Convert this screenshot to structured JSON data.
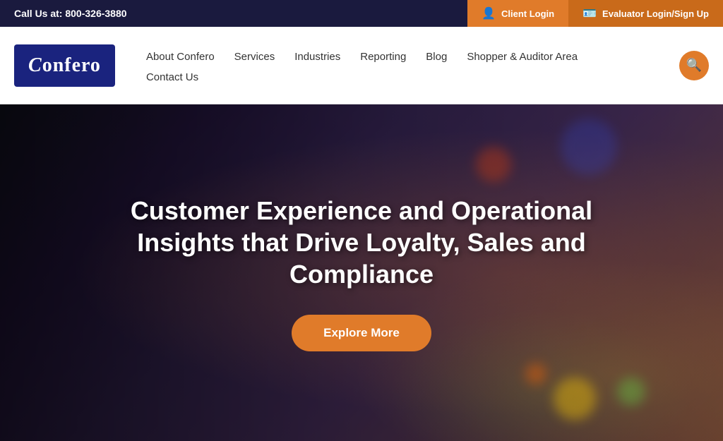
{
  "topbar": {
    "phone_label": "Call Us at:",
    "phone_number": "800-326-3880",
    "client_login_label": "Client Login",
    "evaluator_login_label": "Evaluator Login/Sign Up"
  },
  "logo": {
    "text": "Confero"
  },
  "nav": {
    "links_row1": [
      {
        "label": "About Confero",
        "id": "about"
      },
      {
        "label": "Services",
        "id": "services"
      },
      {
        "label": "Industries",
        "id": "industries"
      },
      {
        "label": "Reporting",
        "id": "reporting"
      },
      {
        "label": "Blog",
        "id": "blog"
      },
      {
        "label": "Shopper & Auditor Area",
        "id": "shopper"
      }
    ],
    "links_row2": [
      {
        "label": "Contact Us",
        "id": "contact"
      }
    ]
  },
  "hero": {
    "title": "Customer Experience and Operational Insights that Drive Loyalty, Sales and Compliance",
    "explore_btn": "Explore More"
  }
}
